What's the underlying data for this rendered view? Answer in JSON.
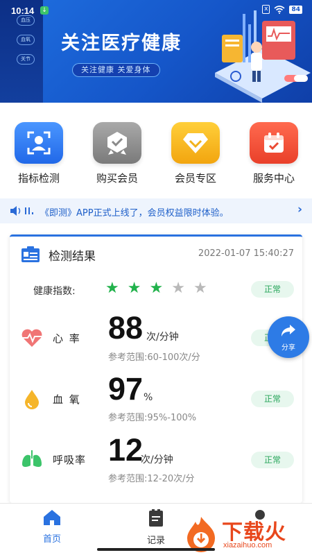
{
  "status_bar": {
    "time": "10:14",
    "battery": "84",
    "sim": "x"
  },
  "banner": {
    "title": "关注医疗健康",
    "subtitle": "关注健康 关爱身体",
    "side_tags": [
      "血压",
      "血氧",
      "关节"
    ]
  },
  "menu": {
    "items": [
      {
        "label": "指标检测",
        "icon": "face-scan-icon",
        "color": "#2f7ff0"
      },
      {
        "label": "购买会员",
        "icon": "medal-icon",
        "color": "#8c8c8c"
      },
      {
        "label": "会员专区",
        "icon": "diamond-icon",
        "color": "#f5b21c"
      },
      {
        "label": "服务中心",
        "icon": "calendar-check-icon",
        "color": "#f0503a"
      }
    ]
  },
  "notice": {
    "text": "《即测》APP正式上线了，会员权益限时体验。"
  },
  "result": {
    "title": "检测结果",
    "datetime": "2022-01-07 15:40:27",
    "health_index_label": "健康指数:",
    "health_index_stars": 3,
    "health_index_max": 5,
    "health_index_status": "正常",
    "metrics": [
      {
        "name": "心 率",
        "value": "88",
        "unit": "次/分钟",
        "range": "参考范围:60-100次/分",
        "status": "正常",
        "icon": "heartbeat-icon"
      },
      {
        "name": "血 氧",
        "value": "97",
        "unit": "%",
        "range": "参考范围:95%-100%",
        "status": "正常",
        "icon": "drop-icon"
      },
      {
        "name": "呼吸率",
        "value": "12",
        "unit": "次/分钟",
        "range": "参考范围:12-20次/分",
        "status": "正常",
        "icon": "lungs-icon"
      }
    ]
  },
  "share": {
    "label": "分享"
  },
  "bottom_nav": {
    "items": [
      {
        "label": "首页",
        "active": true
      },
      {
        "label": "记录",
        "active": false
      }
    ]
  },
  "watermark": {
    "text": "下载火",
    "url": "xiazaihuo.com"
  },
  "colors": {
    "accent": "#2a72e0",
    "ok_green": "#27a55a",
    "star_on": "#22b24c",
    "star_off": "#b9b9b9"
  }
}
